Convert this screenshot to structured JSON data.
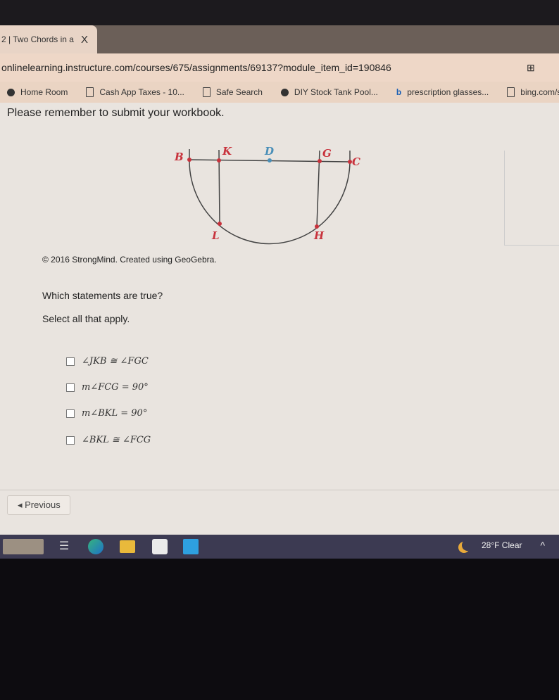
{
  "browser": {
    "tab_title": "2 | Two Chords in a",
    "tab_close": "X",
    "url": "onlinelearning.instructure.com/courses/675/assignments/69137?module_item_id=190846",
    "bookmarks": [
      {
        "label": "Home Room",
        "icon": "globe-icon"
      },
      {
        "label": "Cash App Taxes - 10...",
        "icon": "document-icon"
      },
      {
        "label": "Safe Search",
        "icon": "search-icon"
      },
      {
        "label": "DIY Stock Tank Pool...",
        "icon": "site-icon"
      },
      {
        "label": "prescription glasses...",
        "icon": "bing-icon"
      },
      {
        "label": "bing.com/search",
        "icon": "document-icon"
      }
    ]
  },
  "page": {
    "notice": "Please remember to submit your workbook.",
    "diagram": {
      "points": [
        "B",
        "K",
        "D",
        "G",
        "C",
        "L",
        "H"
      ],
      "point_color": "#c8323c",
      "center_color": "#4a8fb8"
    },
    "credit": "© 2016 StrongMind. Created using GeoGebra.",
    "question": "Which statements are true?",
    "instruction": "Select all that apply.",
    "options": [
      {
        "label": "∠JKB ≅ ∠FGC",
        "checked": false
      },
      {
        "label": "m∠FCG = 90°",
        "checked": false
      },
      {
        "label": "m∠BKL = 90°",
        "checked": false
      },
      {
        "label": "∠BKL ≅ ∠FCG",
        "checked": false
      }
    ],
    "previous_label": "◂ Previous"
  },
  "taskbar": {
    "weather": "28°F  Clear",
    "apps": [
      "task-view-icon",
      "edge-icon",
      "file-explorer-icon",
      "store-icon",
      "mail-icon"
    ]
  }
}
